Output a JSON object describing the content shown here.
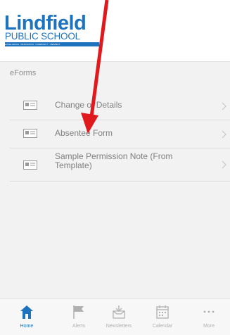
{
  "colors": {
    "brand_blue": "#1e73be",
    "annotation_red": "#e0191c",
    "background": "#f2f2f2"
  },
  "header": {
    "logo_main": "Lindfield",
    "logo_sub": "PUBLIC SCHOOL",
    "logo_tagline": "EXCELLENCE · INNOVATION · COMMUNITY · RESPECT"
  },
  "section": {
    "title": "eForms"
  },
  "forms": [
    {
      "label": "Change of Details",
      "icon": "id-card-icon"
    },
    {
      "label": "Absentee Form",
      "icon": "id-card-icon"
    },
    {
      "label": "Sample Permission Note (From Template)",
      "icon": "id-card-icon"
    }
  ],
  "nav": {
    "tabs": [
      {
        "label": "Home",
        "icon": "home-icon",
        "active": true
      },
      {
        "label": "Alerts",
        "icon": "flag-icon"
      },
      {
        "label": "Newsletters",
        "icon": "inbox-icon"
      },
      {
        "label": "Calendar",
        "icon": "calendar-icon"
      },
      {
        "label": "More",
        "icon": "more-icon"
      }
    ]
  }
}
